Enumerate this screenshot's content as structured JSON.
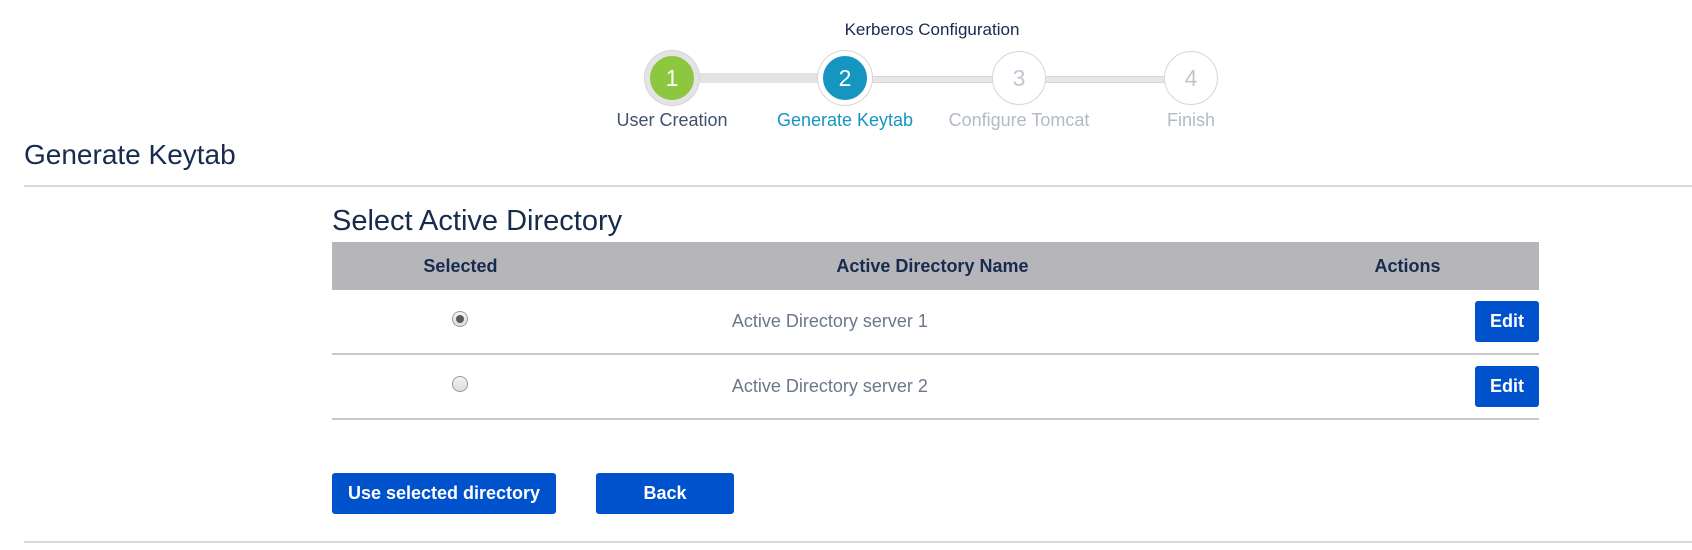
{
  "wizard": {
    "title": "Kerberos Configuration",
    "steps": [
      {
        "number": "1",
        "label": "User Creation",
        "state": "completed"
      },
      {
        "number": "2",
        "label": "Generate Keytab",
        "state": "active"
      },
      {
        "number": "3",
        "label": "Configure Tomcat",
        "state": "pending"
      },
      {
        "number": "4",
        "label": "Finish",
        "state": "pending"
      }
    ]
  },
  "page": {
    "title": "Generate Keytab",
    "section_title": "Select Active Directory"
  },
  "table": {
    "headers": {
      "selected": "Selected",
      "name": "Active Directory Name",
      "actions": "Actions"
    },
    "rows": [
      {
        "name": "Active Directory server 1",
        "selected": true,
        "action_label": "Edit"
      },
      {
        "name": "Active Directory server 2",
        "selected": false,
        "action_label": "Edit"
      }
    ]
  },
  "buttons": {
    "use_selected": "Use selected directory",
    "back": "Back"
  },
  "colors": {
    "completed": "#8dc63f",
    "active": "#1496c1",
    "primary_button": "#0052cc",
    "table_header": "#b5b5ba"
  }
}
